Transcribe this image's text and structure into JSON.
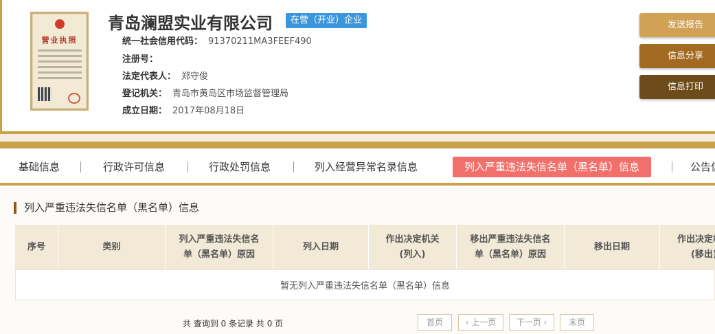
{
  "company": {
    "name": "青岛澜盟实业有限公司",
    "status": "在营（开业）企业"
  },
  "license_card": {
    "title": "营业执照"
  },
  "info": [
    {
      "label": "统一社会信用代码：",
      "value": "91370211MA3FEEF490"
    },
    {
      "label": "注册号：",
      "value": ""
    },
    {
      "label": "法定代表人：",
      "value": "郑守俊"
    },
    {
      "label": "登记机关：",
      "value": "青岛市黄岛区市场监督管理局"
    },
    {
      "label": "成立日期：",
      "value": "2017年08月18日"
    }
  ],
  "actions": {
    "report": "发送报告",
    "share": "信息分享",
    "print": "信息打印"
  },
  "tabs": [
    {
      "label": "基础信息"
    },
    {
      "label": "行政许可信息"
    },
    {
      "label": "行政处罚信息"
    },
    {
      "label": "列入经营异常名录信息"
    },
    {
      "label": "列入严重违法失信名单（黑名单）信息"
    },
    {
      "label": "公告信息"
    }
  ],
  "section": {
    "title": "列入严重违法失信名单（黑名单）信息"
  },
  "table": {
    "columns": [
      "序号",
      "类别",
      "列入严重违法失信名单（黑名单）原因",
      "列入日期",
      "作出决定机关(列入)",
      "移出严重违法失信名单（黑名单）原因",
      "移出日期",
      "作出决定机关(移出)"
    ],
    "empty_text": "暂无列入严重违法失信名单（黑名单）信息"
  },
  "pager": {
    "summary": "共 查询到 0 条记录 共 0 页",
    "first": "首页",
    "prev": "‹ 上一页",
    "next": "下一页 ›",
    "last": "末页"
  },
  "colors": {
    "gold": "#c9a14b",
    "active_tab": "#f2706b",
    "badge": "#3c96dc"
  }
}
